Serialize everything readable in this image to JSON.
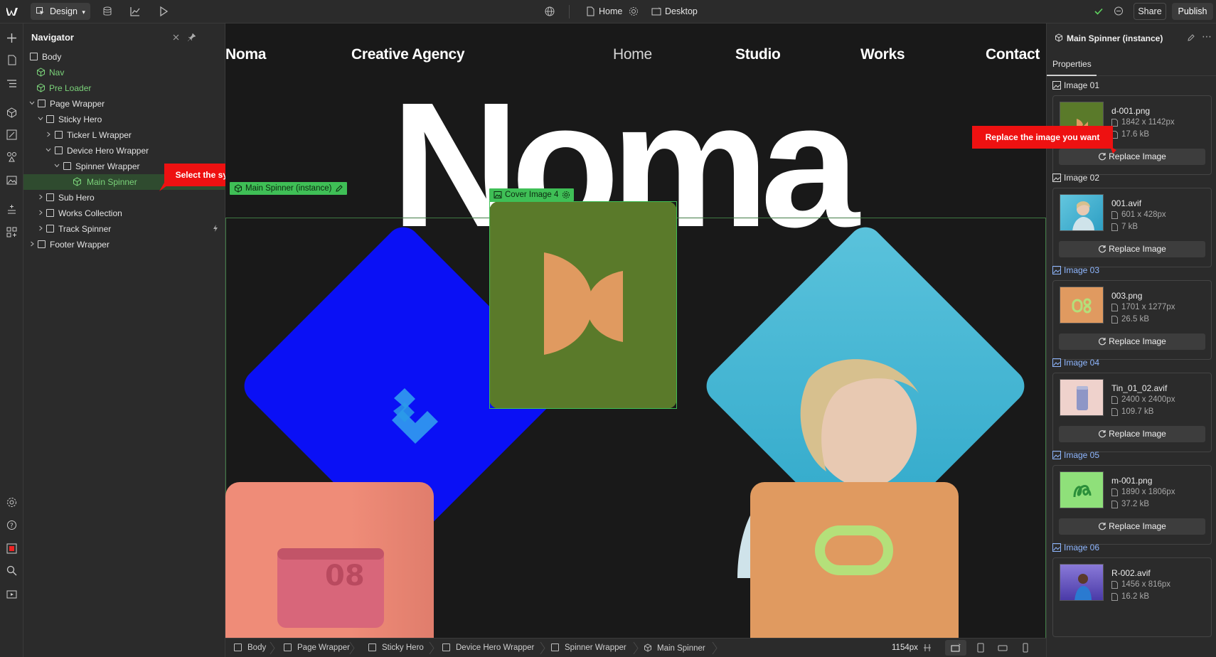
{
  "topbar": {
    "mode_label": "Design",
    "page_label": "Home",
    "breakpoint_label": "Desktop",
    "share_label": "Share",
    "publish_label": "Publish"
  },
  "navigator": {
    "title": "Navigator",
    "items": [
      {
        "label": "Body"
      },
      {
        "label": "Nav"
      },
      {
        "label": "Pre Loader"
      },
      {
        "label": "Page Wrapper"
      },
      {
        "label": "Sticky Hero"
      },
      {
        "label": "Ticker L Wrapper"
      },
      {
        "label": "Device Hero Wrapper"
      },
      {
        "label": "Spinner Wrapper"
      },
      {
        "label": "Main Spinner"
      },
      {
        "label": "Sub Hero"
      },
      {
        "label": "Works Collection"
      },
      {
        "label": "Track Spinner"
      },
      {
        "label": "Footer Wrapper"
      }
    ],
    "callout": "Select the symbol element"
  },
  "canvas": {
    "site_nav": {
      "brand": "Noma",
      "tagline": "Creative Agency",
      "links": [
        "Home",
        "Studio",
        "Works",
        "Contact"
      ]
    },
    "hero_word": "Noma",
    "instance_tag": "Main Spinner (instance)",
    "cover_tag": "Cover Image 4"
  },
  "right_panel": {
    "title": "Main Spinner (instance)",
    "section": "Properties",
    "callout": "Replace the image you want",
    "replace_label": "Replace Image",
    "images": [
      {
        "label": "Image 01",
        "file": "d-001.png",
        "dims": "1842 x 1142px",
        "size": "17.6 kB",
        "highlight": false
      },
      {
        "label": "Image 02",
        "file": "001.avif",
        "dims": "601 x 428px",
        "size": "7 kB",
        "highlight": false
      },
      {
        "label": "Image 03",
        "file": "003.png",
        "dims": "1701 x 1277px",
        "size": "26.5 kB",
        "highlight": true
      },
      {
        "label": "Image 04",
        "file": "Tin_01_02.avif",
        "dims": "2400 x 2400px",
        "size": "109.7 kB",
        "highlight": true
      },
      {
        "label": "Image 05",
        "file": "m-001.png",
        "dims": "1890 x 1806px",
        "size": "37.2 kB",
        "highlight": true
      },
      {
        "label": "Image 06",
        "file": "R-002.avif",
        "dims": "1456 x 816px",
        "size": "16.2 kB",
        "highlight": true
      }
    ]
  },
  "bottombar": {
    "crumbs": [
      "Body",
      "Page Wrapper",
      "Sticky Hero",
      "Device Hero Wrapper",
      "Spinner Wrapper",
      "Main Spinner"
    ],
    "width_label": "1154px"
  },
  "colors": {
    "accent_green": "#3fbf56",
    "callout_red": "#ee1111",
    "tile_blue": "#0a10f5",
    "tile_olive": "#5a7a2a",
    "tile_orange": "#e09a60",
    "tile_salmon": "#ef8c78"
  }
}
